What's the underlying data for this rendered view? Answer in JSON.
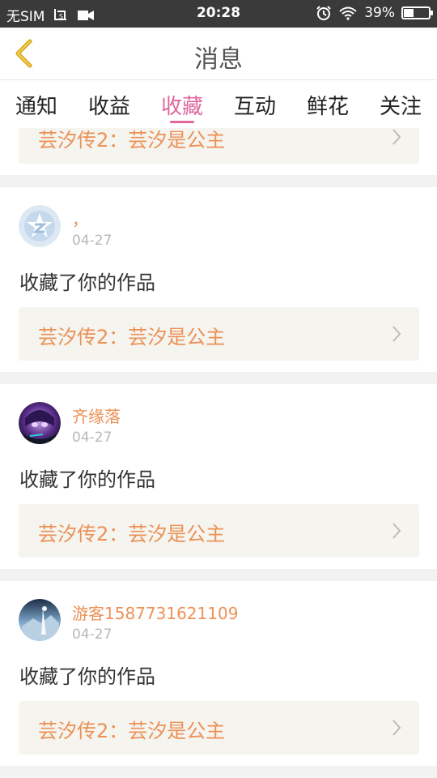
{
  "statusbar": {
    "carrier": "无SIM",
    "time": "20:28",
    "battery": "39%",
    "battery_level": 0.39
  },
  "header": {
    "title": "消息"
  },
  "tabs": [
    {
      "label": "通知"
    },
    {
      "label": "收益"
    },
    {
      "label": "收藏",
      "active": true
    },
    {
      "label": "互动"
    },
    {
      "label": "鲜花"
    },
    {
      "label": "关注"
    }
  ],
  "partial_item": {
    "work_title": "芸汐传2：芸汐是公主"
  },
  "items": [
    {
      "name": "，",
      "date": "04-27",
      "message": "收藏了你的作品",
      "work_title": "芸汐传2：芸汐是公主",
      "avatar": "default-avatar"
    },
    {
      "name": "齐缘落",
      "date": "04-27",
      "message": "收藏了你的作品",
      "work_title": "芸汐传2：芸汐是公主",
      "avatar": "anime-avatar"
    },
    {
      "name": "游客1587731621109",
      "date": "04-27",
      "message": "收藏了你的作品",
      "work_title": "芸汐传2：芸汐是公主",
      "avatar": "scene-avatar"
    }
  ],
  "colors": {
    "accent": "#e0679e",
    "orange": "#ec9156",
    "back_arrow": "#d4a40f"
  }
}
